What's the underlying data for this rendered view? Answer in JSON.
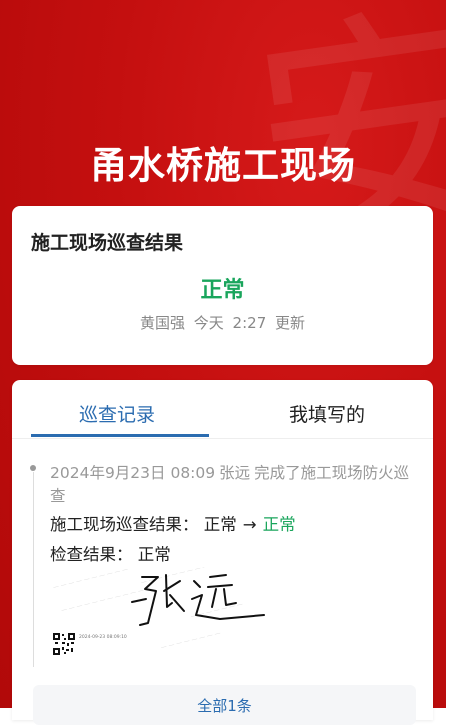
{
  "header": {
    "title": "甬水桥施工现场"
  },
  "summary": {
    "title": "施工现场巡查结果",
    "status": "正常",
    "updated_by": "黄国强",
    "updated_day": "今天",
    "updated_time": "2:27",
    "updated_suffix": "更新",
    "status_color": "#1aa55c"
  },
  "tabs": [
    {
      "label": "巡查记录",
      "active": true
    },
    {
      "label": "我填写的",
      "active": false
    }
  ],
  "record": {
    "datetime": "2024年9月23日 08:09",
    "user": "张远",
    "action": "完成了施工现场防火巡查",
    "result_label": "施工现场巡查结果：",
    "result_from": "正常",
    "arrow": "→",
    "result_to": "正常",
    "check_label": "检查结果：",
    "check_value": "正常",
    "signature_name": "张远",
    "stamp_date": "2024-09-23 08:09:10"
  },
  "more": {
    "label": "全部1条"
  },
  "colors": {
    "brand_red": "#c40f0f",
    "accent_blue": "#2b6cb0",
    "status_green": "#1aa55c"
  }
}
